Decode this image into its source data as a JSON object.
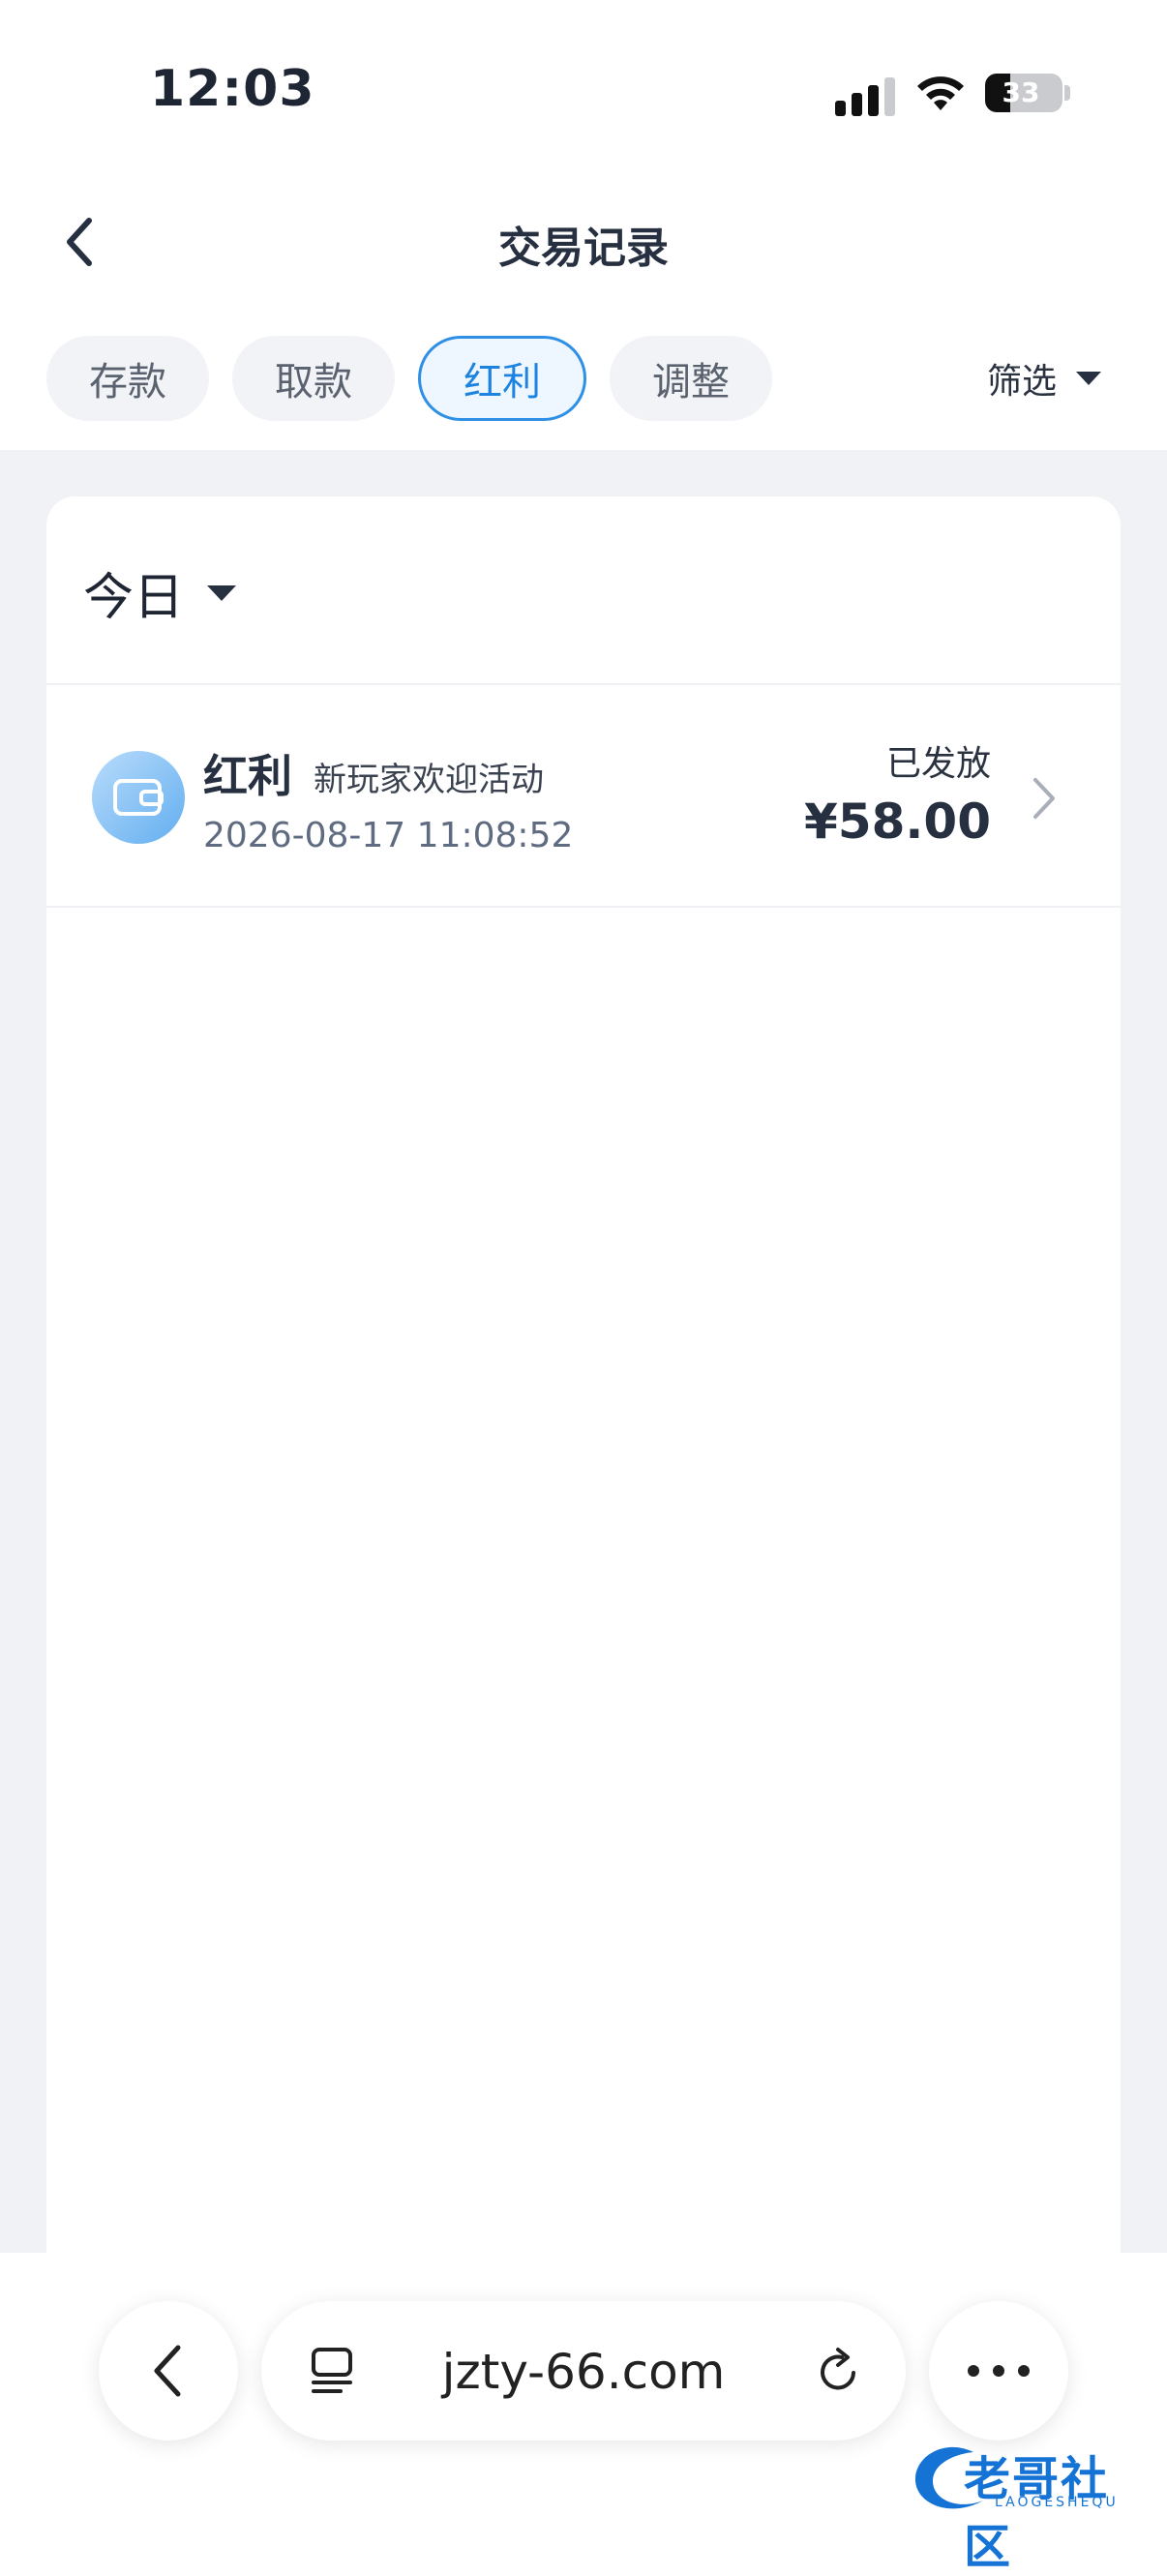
{
  "status_bar": {
    "time": "12:03",
    "battery": "33",
    "battery_level": 0.33
  },
  "header": {
    "title": "交易记录"
  },
  "tabs": [
    {
      "label": "存款",
      "active": false
    },
    {
      "label": "取款",
      "active": false
    },
    {
      "label": "红利",
      "active": true
    },
    {
      "label": "调整",
      "active": false
    }
  ],
  "filter": {
    "label": "筛选"
  },
  "date_filter": {
    "label": "今日"
  },
  "records": [
    {
      "type": "红利",
      "description": "新玩家欢迎活动",
      "datetime": "2026-08-17 11:08:52",
      "status": "已发放",
      "amount": "¥58.00"
    }
  ],
  "browser": {
    "url": "jzty-66.com"
  },
  "watermark": {
    "text": "老哥社区",
    "sub": "LAOGESHEQU"
  },
  "colors": {
    "accent": "#1d83e0",
    "tab_bg": "#f2f3f6",
    "page_bg": "#f1f2f6",
    "icon_gradient_end": "#62aef0"
  }
}
